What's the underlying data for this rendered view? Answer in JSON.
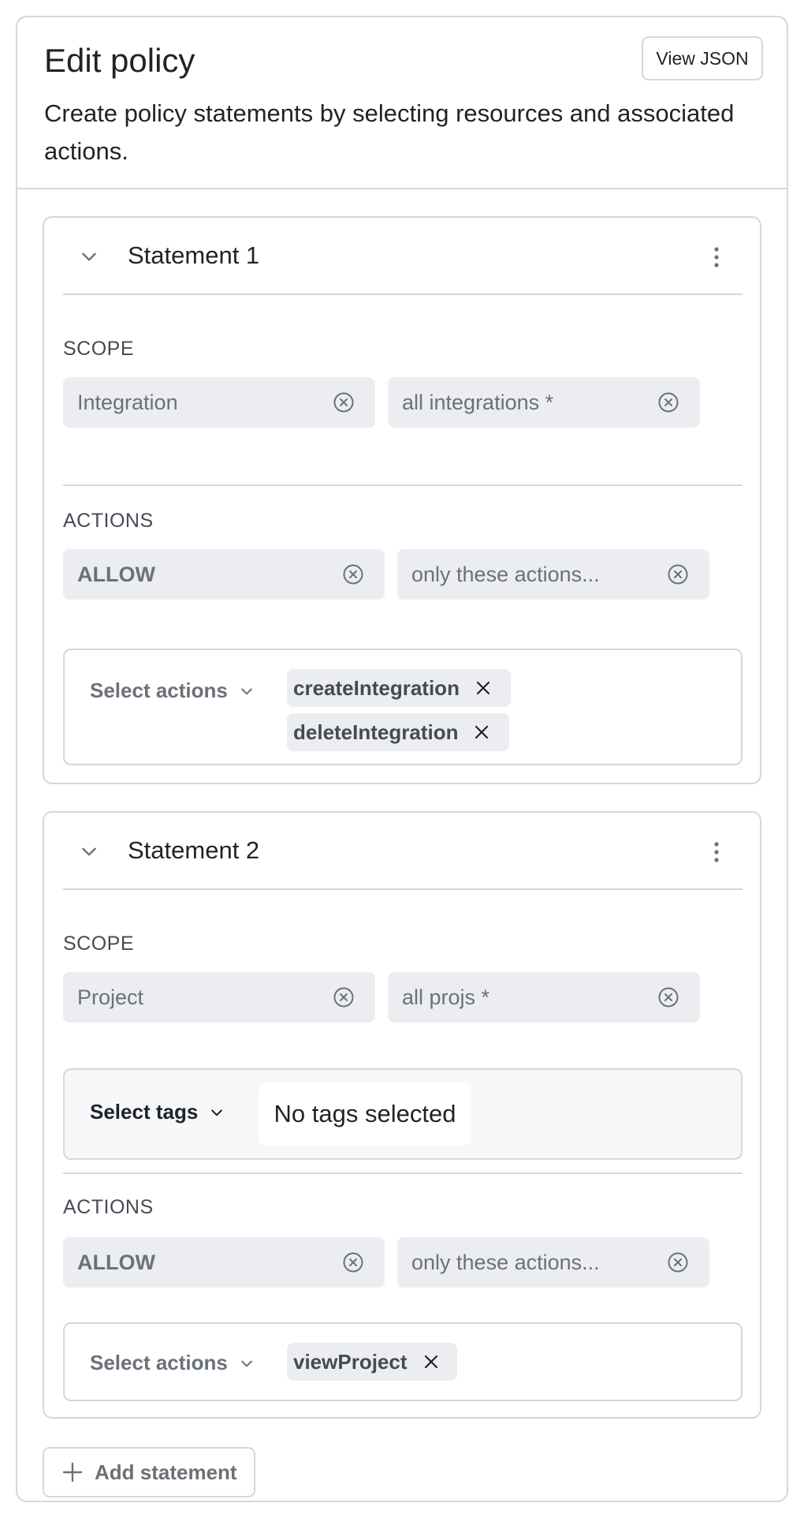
{
  "header": {
    "title": "Edit policy",
    "description": "Create policy statements by selecting resources and associated actions.",
    "view_json_label": "View JSON"
  },
  "statements": [
    {
      "title": "Statement 1",
      "scope_label": "SCOPE",
      "scope_resource": "Integration",
      "scope_target": "all integrations *",
      "actions_label": "ACTIONS",
      "effect": "ALLOW",
      "actions_mode": "only these actions...",
      "select_actions_label": "Select actions",
      "selected_actions": [
        "createIntegration",
        "deleteIntegration"
      ]
    },
    {
      "title": "Statement 2",
      "scope_label": "SCOPE",
      "scope_resource": "Project",
      "scope_target": "all projs *",
      "select_tags_label": "Select tags",
      "tags_empty_text": "No tags selected",
      "actions_label": "ACTIONS",
      "effect": "ALLOW",
      "actions_mode": "only these actions...",
      "select_actions_label": "Select actions",
      "selected_actions": [
        "viewProject"
      ]
    }
  ],
  "add_statement_label": "Add statement",
  "icons": {
    "collapse": "chevron-down-icon",
    "menu": "more-vertical-icon",
    "clear": "circle-x-icon",
    "remove": "x-icon",
    "add": "plus-icon"
  }
}
